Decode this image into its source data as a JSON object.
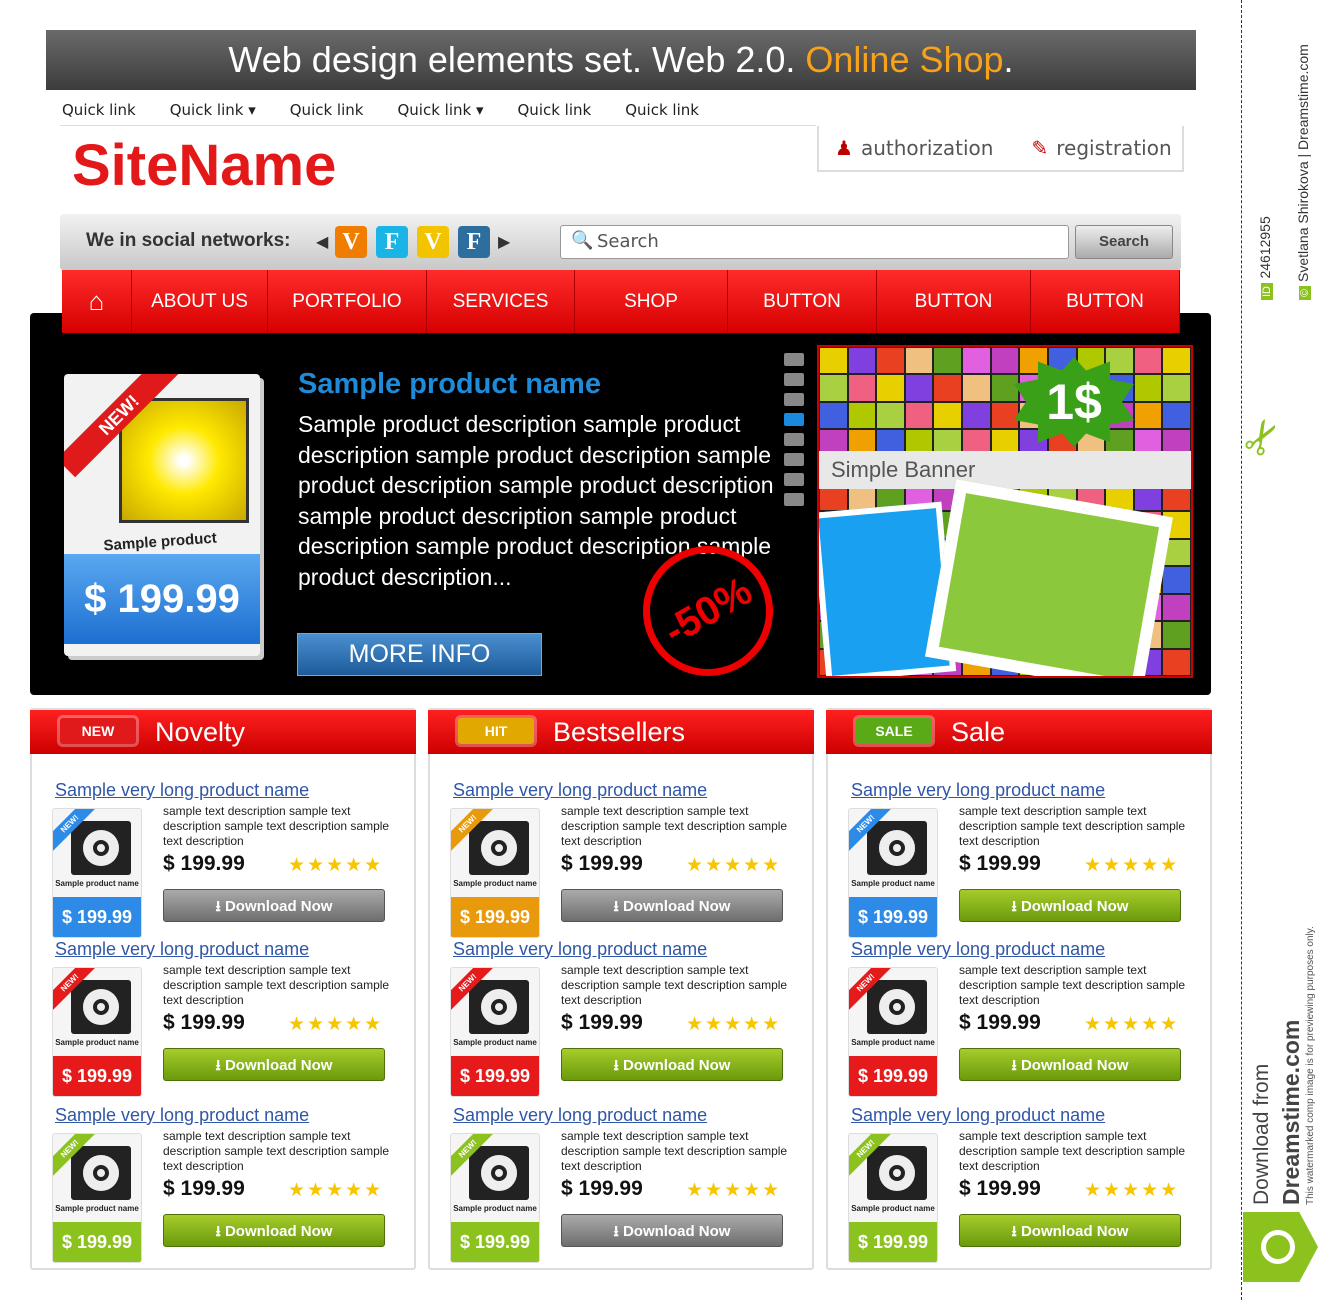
{
  "title": {
    "main": "Web design elements set. Web 2.0. ",
    "highlight": "Online Shop",
    "end": "."
  },
  "quick_links": [
    {
      "label": "Quick link",
      "dropdown": false
    },
    {
      "label": "Quick link",
      "dropdown": true
    },
    {
      "label": "Quick link",
      "dropdown": false
    },
    {
      "label": "Quick link",
      "dropdown": true
    },
    {
      "label": "Quick link",
      "dropdown": false
    },
    {
      "label": "Quick link",
      "dropdown": false
    }
  ],
  "site_name": "SiteName",
  "auth": {
    "authorization": "authorization",
    "registration": "registration"
  },
  "social": {
    "label": "We in social networks:",
    "icons": [
      {
        "letter": "V",
        "color": "#f07d00"
      },
      {
        "letter": "F",
        "color": "#1ab4e6"
      },
      {
        "letter": "V",
        "color": "#f2c400"
      },
      {
        "letter": "F",
        "color": "#2d6e9e"
      }
    ]
  },
  "search": {
    "placeholder": "Search",
    "button": "Search"
  },
  "nav": [
    "ABOUT US",
    "PORTFOLIO",
    "SERVICES",
    "SHOP",
    "BUTTON",
    "BUTTON",
    "BUTTON"
  ],
  "banner": {
    "new_tag": "NEW!",
    "box_name": "Sample product name",
    "box_price": "$ 199.99",
    "product_name": "Sample product name",
    "description": "Sample product description sample product description sample product description sample product description sample product description sample product description sample product description sample product description sample product description...",
    "more_info": "MORE INFO",
    "discount": "-50%",
    "slides": 8,
    "active_slide": 3
  },
  "ad": {
    "price": "1$",
    "label": "Simple Banner"
  },
  "columns": [
    {
      "title": "Novelty",
      "badge": "NEW",
      "badge_color": "#e01a1a",
      "cards": [
        {
          "name": "Sample very long product name",
          "box_color": "#2d8ae6",
          "button_style": "gray"
        },
        {
          "name": "Sample very long product name",
          "box_color": "#e61a1a",
          "button_style": "green"
        },
        {
          "name": "Sample very long product name",
          "box_color": "#8cc21e",
          "button_style": "green"
        }
      ]
    },
    {
      "title": "Bestsellers",
      "badge": "HIT",
      "badge_color": "#e0a800",
      "cards": [
        {
          "name": "Sample very long product name",
          "box_color": "#e89a0c",
          "button_style": "gray"
        },
        {
          "name": "Sample very long product name",
          "box_color": "#e61a1a",
          "button_style": "green"
        },
        {
          "name": "Sample very long product name",
          "box_color": "#8cc21e",
          "button_style": "gray"
        }
      ]
    },
    {
      "title": "Sale",
      "badge": "SALE",
      "badge_color": "#5aaa18",
      "cards": [
        {
          "name": "Sample very long product name",
          "box_color": "#2d8ae6",
          "button_style": "green"
        },
        {
          "name": "Sample very long product name",
          "box_color": "#e61a1a",
          "button_style": "green"
        },
        {
          "name": "Sample very long product name",
          "box_color": "#8cc21e",
          "button_style": "green"
        }
      ]
    }
  ],
  "card_common": {
    "new_tag": "NEW!",
    "box_name": "Sample product name",
    "description": "sample text description sample text description sample text description sample text description",
    "price": "$ 199.99",
    "rating": 5,
    "download": "Download Now"
  },
  "watermark": {
    "id_label": "ID",
    "id": "24612955",
    "author": "Svetlana Shirokova | Dreamstime.com",
    "download_from": "Download from",
    "site": "Dreamstime.com",
    "notice": "This watermarked comp image is for previewing purposes only."
  }
}
